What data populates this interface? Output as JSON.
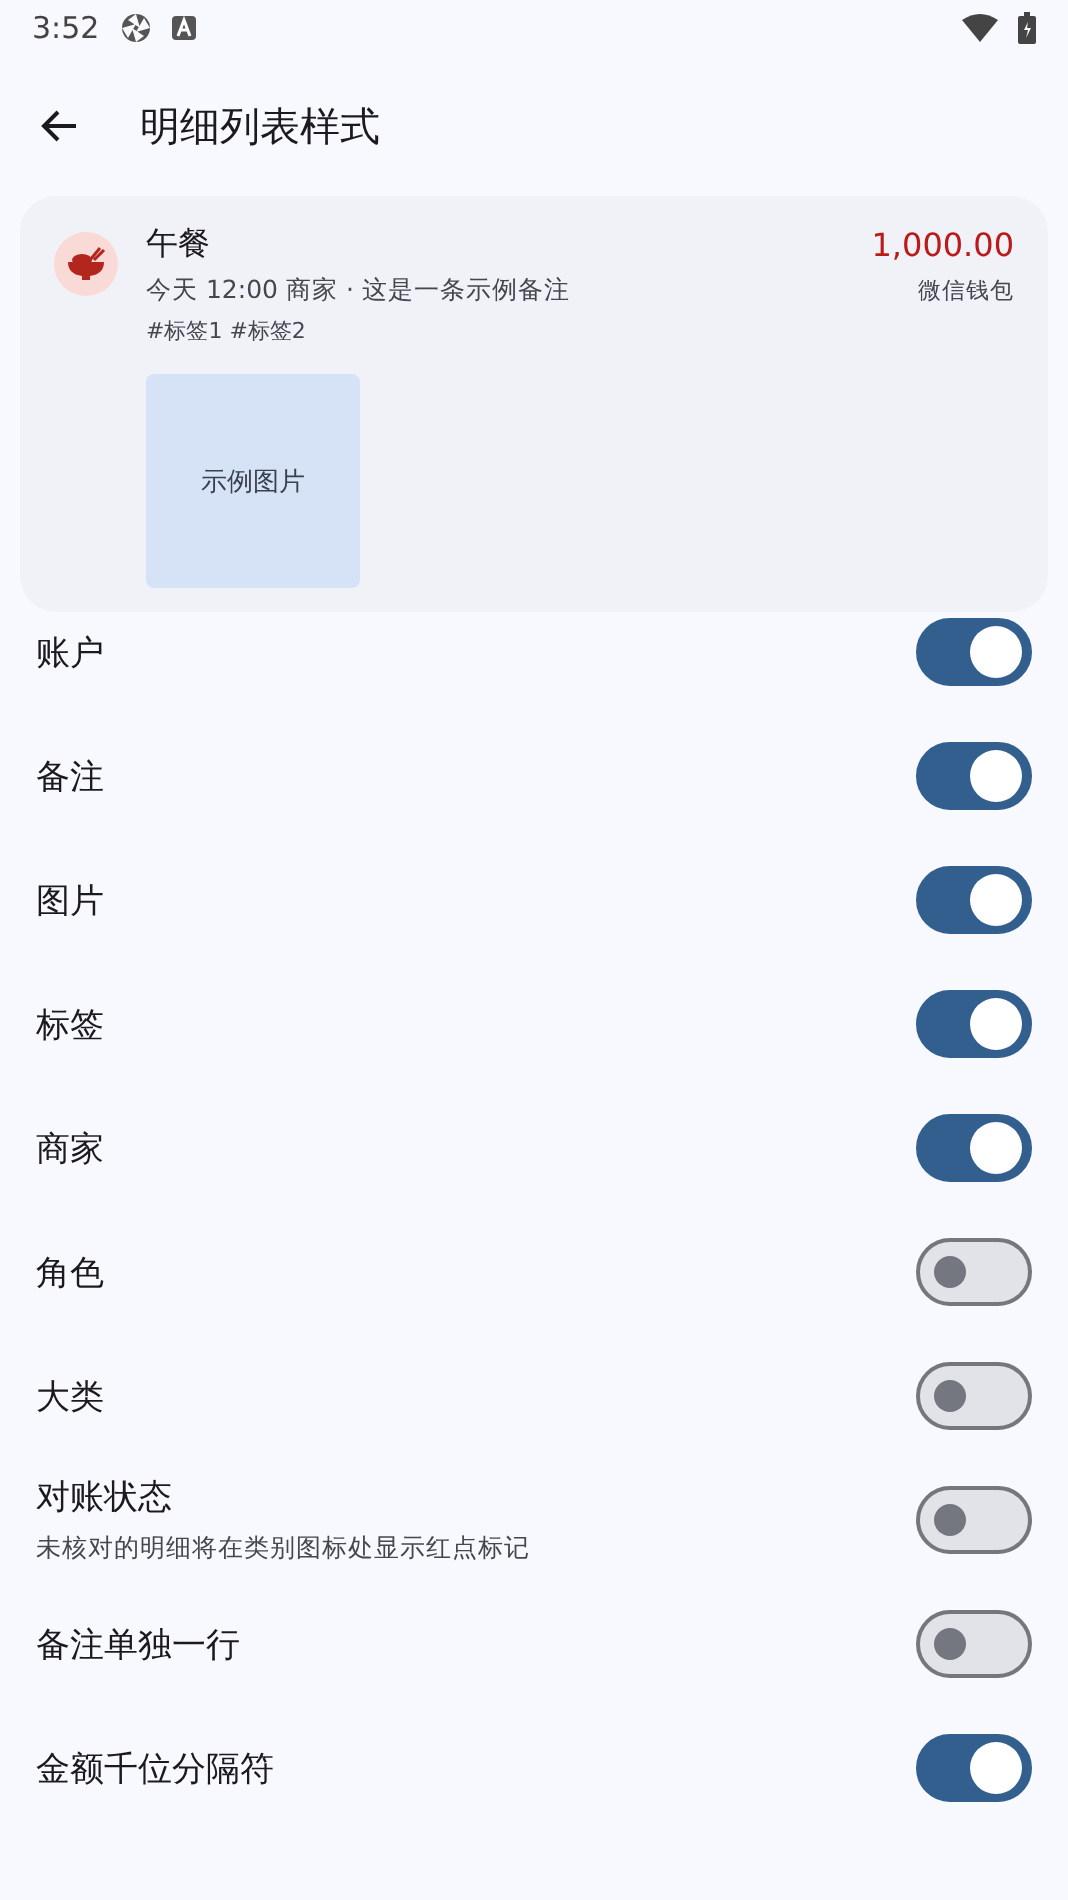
{
  "status_bar": {
    "time": "3:52"
  },
  "app_bar": {
    "title": "明细列表样式"
  },
  "preview": {
    "title": "午餐",
    "amount": "1,000.00",
    "subtitle": "今天 12:00 商家 · 这是一条示例备注",
    "account": "微信钱包",
    "tags": "#标签1 #标签2",
    "image_label": "示例图片"
  },
  "settings": [
    {
      "label": "账户",
      "on": true
    },
    {
      "label": "备注",
      "on": true
    },
    {
      "label": "图片",
      "on": true
    },
    {
      "label": "标签",
      "on": true
    },
    {
      "label": "商家",
      "on": true
    },
    {
      "label": "角色",
      "on": false
    },
    {
      "label": "大类",
      "on": false
    },
    {
      "label": "对账状态",
      "description": "未核对的明细将在类别图标处显示红点标记",
      "on": false
    },
    {
      "label": "备注单独一行",
      "on": false
    },
    {
      "label": "金额千位分隔符",
      "on": true
    }
  ]
}
